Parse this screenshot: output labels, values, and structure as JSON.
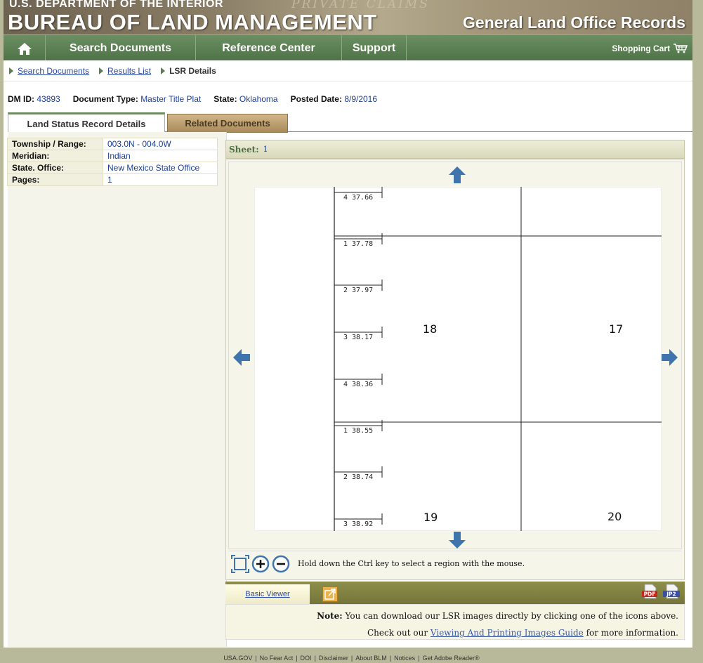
{
  "banner": {
    "dept": "U.S. DEPARTMENT OF THE INTERIOR",
    "bureau": "BUREAU OF LAND MANAGEMENT",
    "subtitle": "General Land Office Records",
    "watermark": "PRIVATE CLAIMS"
  },
  "nav": {
    "home_icon": "house-icon",
    "items": [
      {
        "label": "Search Documents"
      },
      {
        "label": "Reference Center"
      },
      {
        "label": "Support"
      }
    ],
    "cart_label": "Shopping Cart",
    "cart_icon": "cart-icon"
  },
  "breadcrumb": {
    "items": [
      "Search Documents",
      "Results List"
    ],
    "current": "LSR Details"
  },
  "meta": {
    "dm_id_label": "DM ID:",
    "dm_id": "43893",
    "doc_type_label": "Document Type:",
    "doc_type": "Master Title Plat",
    "state_label": "State:",
    "state": "Oklahoma",
    "posted_label": "Posted Date:",
    "posted": "8/9/2016"
  },
  "tabs": {
    "active": "Land Status Record Details",
    "inactive": "Related Documents"
  },
  "props": [
    {
      "k": "Township / Range:",
      "v": "003.0N - 004.0W"
    },
    {
      "k": "Meridian:",
      "v": "Indian"
    },
    {
      "k": "State. Office:",
      "v": "New Mexico State Office"
    },
    {
      "k": "Pages:",
      "v": "1"
    }
  ],
  "sheet": {
    "label": "Sheet:",
    "value": "1"
  },
  "plat": {
    "lots": [
      "4 37.66",
      "1 37.78",
      "2 37.97",
      "3 38.17",
      "4 38.36",
      "1 38.55",
      "2 38.74",
      "3 38.92"
    ],
    "sections": [
      "18",
      "17",
      "19",
      "20"
    ]
  },
  "toolbar": {
    "hint": "Hold down the Ctrl key to select a region with the mouse."
  },
  "download": {
    "basic_viewer": "Basic Viewer",
    "pdf": "PDF",
    "jp2": "JP2"
  },
  "note": {
    "bold": "Note:",
    "line1": "You can download our LSR images directly by clicking one of the icons above.",
    "line2_pre": "Check out our",
    "guide_link": "Viewing And Printing Images Guide",
    "line2_post": "for more information."
  },
  "footer": [
    "USA.GOV",
    "No Fear Act",
    "DOI",
    "Disclaimer",
    "About BLM",
    "Notices",
    "Get Adobe Reader®"
  ],
  "colors": {
    "nav_green": "#4e7347",
    "link_blue": "#2b4aa5",
    "arrow_blue": "#3f74ad",
    "olive": "#75753a"
  }
}
